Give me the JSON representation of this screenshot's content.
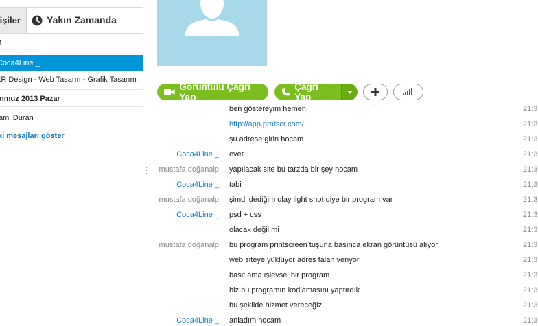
{
  "sidebar": {
    "tabs": {
      "contacts": "işiler",
      "recent": "Yakın Zamanda"
    },
    "section_top": "n",
    "items": [
      {
        "label": "Coca4Line _",
        "selected": true
      },
      {
        "label": "KR Design - Web Tasarım- Grafik Tasarım",
        "selected": false
      }
    ],
    "date_header": "mmuz 2013 Pazar",
    "item_below_date": "ami Duran",
    "show_older_link": "ki mesajları göster"
  },
  "toolbar": {
    "video_call_label": "Görüntülü Çağrı Yap",
    "call_label": "Çağrı Yap",
    "add_icon": "plus-icon",
    "signal_icon": "signal-bars-icon"
  },
  "colors": {
    "accent_green": "#7bbf1e",
    "selection_blue": "#0095d9",
    "link_blue": "#1a7fc1",
    "avatar_bg": "#a6d8ea"
  },
  "messages": [
    {
      "sender": "",
      "text": "ben göstereyim hemen",
      "time": "21:3",
      "link": false
    },
    {
      "sender": "",
      "text": "http://app.prntscr.com/",
      "time": "21:3",
      "link": true
    },
    {
      "sender": "",
      "text": "şu adrese girin hocam",
      "time": "21:3",
      "link": false
    },
    {
      "sender": "Coca4Line _",
      "text": "evet",
      "time": "21:3",
      "link": false,
      "me": true
    },
    {
      "sender": "mustafa doğanalp",
      "text": "yapılacak site bu tarzda bir şey hocam",
      "time": "21:3",
      "link": false
    },
    {
      "sender": "Coca4Line _",
      "text": "tabi",
      "time": "21:3",
      "link": false,
      "me": true
    },
    {
      "sender": "mustafa doğanalp",
      "text": "şimdi dediğim olay light shot diye bir program var",
      "time": "21:3",
      "link": false
    },
    {
      "sender": "Coca4Line _",
      "text": "psd + css",
      "time": "21:3",
      "link": false,
      "me": true
    },
    {
      "sender": "",
      "text": "olacak değil mi",
      "time": "21:3",
      "link": false
    },
    {
      "sender": "mustafa doğanalp",
      "text": "bu program printscreen tuşuna basınca ekran görüntüsü alıyor",
      "time": "21:3",
      "link": false
    },
    {
      "sender": "",
      "text": "web siteye yüklüyor adres falan veriyor",
      "time": "21:3",
      "link": false
    },
    {
      "sender": "",
      "text": "basit ama işlevsel bir program",
      "time": "21:3",
      "link": false
    },
    {
      "sender": "",
      "text": "biz bu programın kodlamasını yaptırdık",
      "time": "21:3",
      "link": false
    },
    {
      "sender": "",
      "text": "bu şekilde hizmet vereceğiz",
      "time": "21:3",
      "link": false
    },
    {
      "sender": "Coca4Line _",
      "text": "anladım hocam",
      "time": "21:3",
      "link": false,
      "me": true
    }
  ]
}
